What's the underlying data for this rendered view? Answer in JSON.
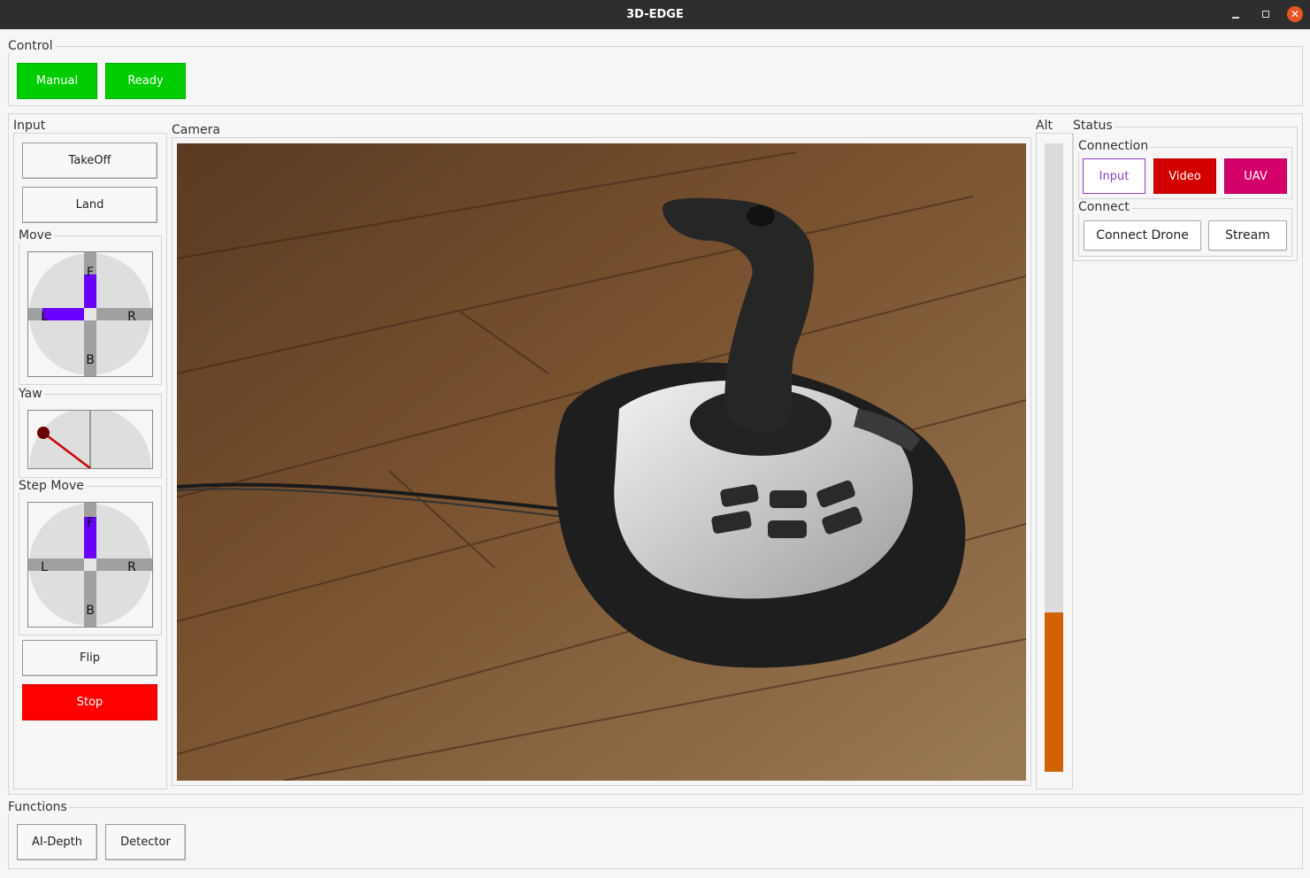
{
  "window": {
    "title": "3D-EDGE"
  },
  "control": {
    "label": "Control",
    "manual_label": "Manual",
    "ready_label": "Ready"
  },
  "input": {
    "label": "Input",
    "takeoff_label": "TakeOff",
    "land_label": "Land",
    "move_label": "Move",
    "yaw_label": "Yaw",
    "step_move_label": "Step Move",
    "flip_label": "Flip",
    "stop_label": "Stop",
    "dir_f": "F",
    "dir_b": "B",
    "dir_l": "L",
    "dir_r": "R",
    "move_forward": 0.6,
    "move_left": 0.75,
    "step_forward": 0.75
  },
  "camera": {
    "label": "Camera"
  },
  "alt": {
    "label": "Alt",
    "level": 0.254
  },
  "status": {
    "label": "Status",
    "connection_label": "Connection",
    "input_label": "Input",
    "video_label": "Video",
    "uav_label": "UAV",
    "connect_label": "Connect",
    "connect_drone_label": "Connect Drone",
    "stream_label": "Stream"
  },
  "functions": {
    "label": "Functions",
    "ai_depth_label": "AI-Depth",
    "detector_label": "Detector"
  },
  "colors": {
    "active_green": "#00cc00",
    "stop_red": "#ff0000",
    "axis_purple": "#6a00ff",
    "video_red": "#d40000",
    "uav_magenta": "#d4006a",
    "input_purple": "#8a3fc8",
    "alt_orange": "#d06200",
    "yaw_line_red": "#cc0000",
    "yaw_knob": "#6b0000"
  }
}
